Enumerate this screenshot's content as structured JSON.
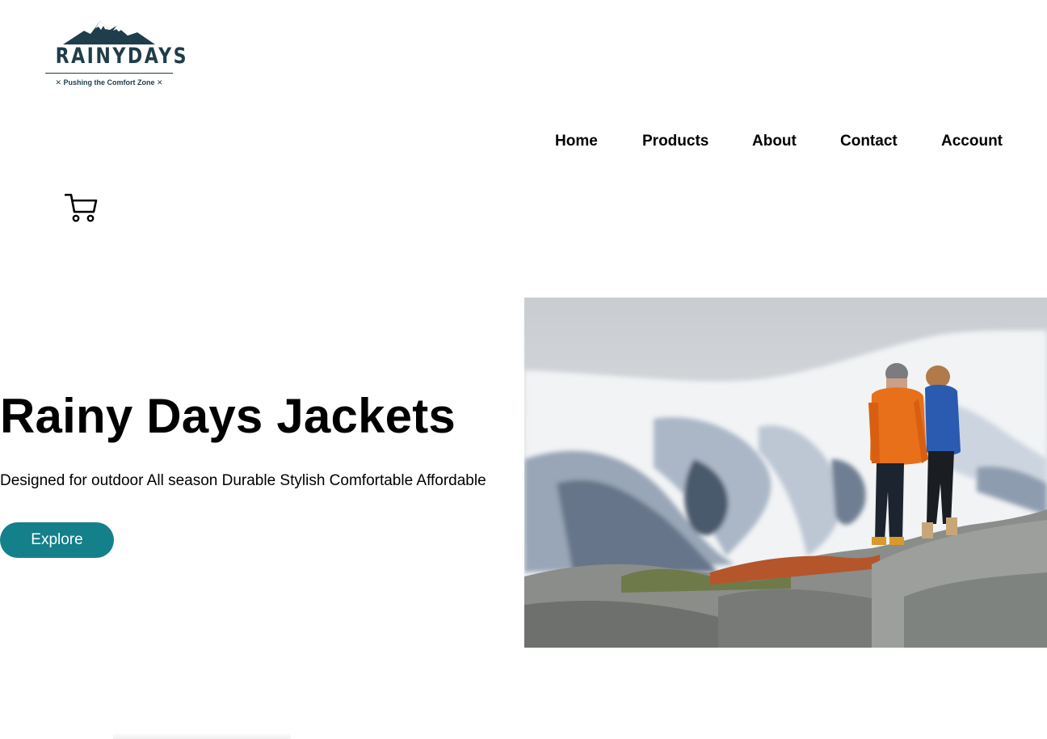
{
  "brand": {
    "name": "RAINYDAYS",
    "tagline": "✕ Pushing the Comfort Zone ✕",
    "color": "#1f3d4a"
  },
  "nav": {
    "items": [
      {
        "label": "Home"
      },
      {
        "label": "Products"
      },
      {
        "label": "About"
      },
      {
        "label": "Contact"
      },
      {
        "label": "Account"
      }
    ]
  },
  "cart": {
    "icon": "cart-icon"
  },
  "hero": {
    "title": "Rainy Days Jackets",
    "subtitle": "Designed for outdoor All season Durable Stylish Comfortable Affordable",
    "button_label": "Explore",
    "accent": "#14808a",
    "image": "two-hikers-snowy-mountain-photo"
  }
}
